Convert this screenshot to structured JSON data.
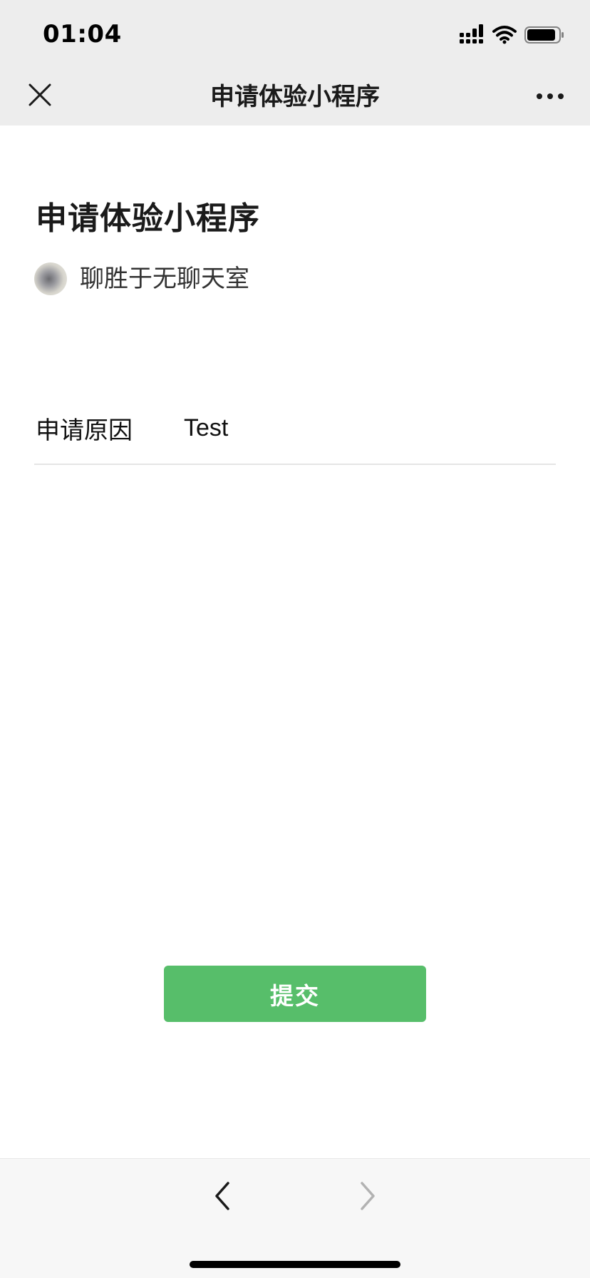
{
  "status_bar": {
    "time": "01:04",
    "icons": [
      "signal-icon",
      "wifi-icon",
      "battery-icon"
    ]
  },
  "nav": {
    "title": "申请体验小程序",
    "left_icon": "close-icon",
    "right_icon": "more-icon"
  },
  "content": {
    "heading": "申请体验小程序",
    "app_name": "聊胜于无聊天室",
    "form": {
      "reason_label": "申请原因",
      "reason_value": "Test"
    },
    "submit_label": "提交"
  },
  "toolbar": {
    "back_icon": "chevron-left-icon",
    "forward_icon": "chevron-right-icon"
  },
  "colors": {
    "primary_green": "#57be6a",
    "bar_gray": "#ededed",
    "toolbar_gray": "#f7f7f7"
  }
}
